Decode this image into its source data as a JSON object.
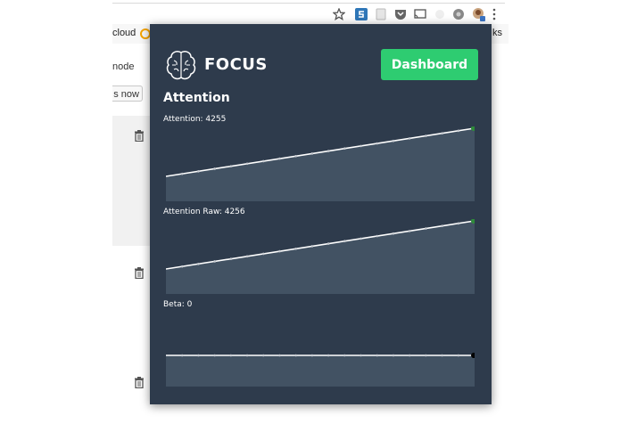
{
  "browser": {
    "bookmarks": {
      "left_fragment": "cloud",
      "right_fragment": "ks"
    }
  },
  "background_page": {
    "mode_text": "node",
    "button_label": "s now"
  },
  "popup": {
    "brand": "FOCUS",
    "dashboard_button": "Dashboard",
    "section_title": "Attention",
    "metrics": [
      {
        "label": "Attention: 4255",
        "trend": "rising",
        "dot_color": "#2e8b3a"
      },
      {
        "label": "Attention Raw: 4256",
        "trend": "rising",
        "dot_color": "#2e8b3a"
      },
      {
        "label": "Beta: 0",
        "trend": "flat",
        "dot_color": "#000000"
      }
    ]
  },
  "colors": {
    "popup_bg": "#2e3b4c",
    "chart_fill": "#425263",
    "accent_green": "#2ecc71"
  }
}
